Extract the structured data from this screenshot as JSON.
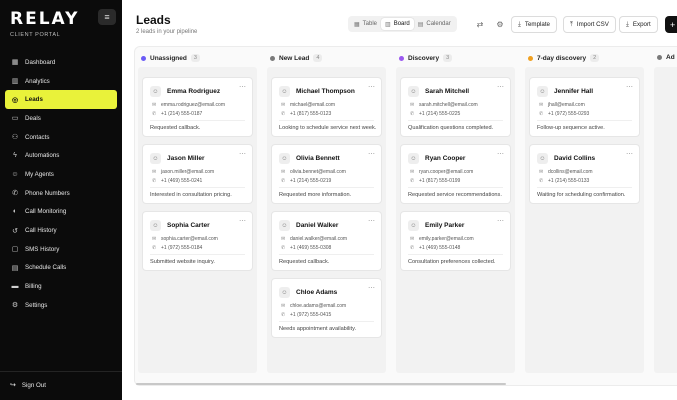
{
  "app": {
    "logo": "RELAY",
    "logo_sub": "CLIENT PORTAL"
  },
  "sidebar": {
    "items": [
      {
        "label": "Dashboard",
        "icon": "grid-icon"
      },
      {
        "label": "Analytics",
        "icon": "chart-icon"
      },
      {
        "label": "Leads",
        "icon": "target-icon",
        "active": true
      },
      {
        "label": "Deals",
        "icon": "briefcase-icon"
      },
      {
        "label": "Contacts",
        "icon": "users-icon"
      },
      {
        "label": "Automations",
        "icon": "zap-icon"
      },
      {
        "label": "My Agents",
        "icon": "user-icon"
      },
      {
        "label": "Phone Numbers",
        "icon": "phone-icon"
      },
      {
        "label": "Call Monitoring",
        "icon": "headset-icon"
      },
      {
        "label": "Call History",
        "icon": "history-icon"
      },
      {
        "label": "SMS History",
        "icon": "message-icon"
      },
      {
        "label": "Schedule Calls",
        "icon": "calendar-icon"
      },
      {
        "label": "Billing",
        "icon": "card-icon"
      },
      {
        "label": "Settings",
        "icon": "gear-icon"
      }
    ],
    "sign_out": "Sign Out"
  },
  "header": {
    "title": "Leads",
    "subtitle": "2 leads in your pipeline",
    "views": [
      {
        "label": "Table",
        "icon": "table-icon"
      },
      {
        "label": "Board",
        "icon": "board-icon",
        "active": true
      },
      {
        "label": "Calendar",
        "icon": "calendar-icon"
      }
    ],
    "template_label": "Template",
    "import_label": "Import CSV",
    "export_label": "Export",
    "add_label": "+"
  },
  "colors": {
    "accent": "#e9f23a",
    "unassigned": "#6b5cf6",
    "new_lead": "#7a7a7a",
    "discovery": "#9b59f0",
    "seven_day": "#f0a020"
  },
  "columns": [
    {
      "title": "Unassigned",
      "count": "3",
      "dot_color": "#6b5cf6",
      "cards": [
        {
          "name": "Emma Rodriguez",
          "email": "emma.rodriguez@email.com",
          "phone": "+1 (214) 555-0187",
          "note": "Requested callback."
        },
        {
          "name": "Jason Miller",
          "email": "jason.miller@email.com",
          "phone": "+1 (469) 555-0241",
          "note": "Interested in consultation pricing."
        },
        {
          "name": "Sophia Carter",
          "email": "sophia.carter@email.com",
          "phone": "+1 (972) 555-0184",
          "note": "Submitted website inquiry."
        }
      ]
    },
    {
      "title": "New Lead",
      "count": "4",
      "dot_color": "#7a7a7a",
      "cards": [
        {
          "name": "Michael Thompson",
          "email": "michael@email.com",
          "phone": "+1 (817) 555-0123",
          "note": "Looking to schedule service next week."
        },
        {
          "name": "Olivia Bennett",
          "email": "olivia.bennet@email.com",
          "phone": "+1 (214) 555-0219",
          "note": "Requested more information."
        },
        {
          "name": "Daniel Walker",
          "email": "daniel.walker@email.com",
          "phone": "+1 (469) 555-0308",
          "note": "Requested callback."
        },
        {
          "name": "Chloe Adams",
          "email": "chloe.adams@email.com",
          "phone": "+1 (972) 555-0415",
          "note": "Needs appointment availability."
        }
      ]
    },
    {
      "title": "Discovery",
      "count": "3",
      "dot_color": "#9b59f0",
      "cards": [
        {
          "name": "Sarah Mitchell",
          "email": "sarah.mitchell@email.com",
          "phone": "+1 (214) 555-0225",
          "note": "Qualification questions completed."
        },
        {
          "name": "Ryan Cooper",
          "email": "ryan.cooper@email.com",
          "phone": "+1 (817) 555-0199",
          "note": "Requested service recommendations."
        },
        {
          "name": "Emily Parker",
          "email": "emily.parker@email.com",
          "phone": "+1 (469) 555-0148",
          "note": "Consultation preferences collected."
        }
      ]
    },
    {
      "title": "7-day discovery",
      "count": "2",
      "dot_color": "#f0a020",
      "cards": [
        {
          "name": "Jennifer Hall",
          "email": "jhall@email.com",
          "phone": "+1 (972) 555-0293",
          "note": "Follow-up sequence active."
        },
        {
          "name": "David Collins",
          "email": "dcollins@email.com",
          "phone": "+1 (214) 555-0133",
          "note": "Waiting for scheduling confirmation."
        }
      ]
    },
    {
      "title": "Ad",
      "count": "",
      "dot_color": "#7a7a7a",
      "cards": []
    }
  ]
}
